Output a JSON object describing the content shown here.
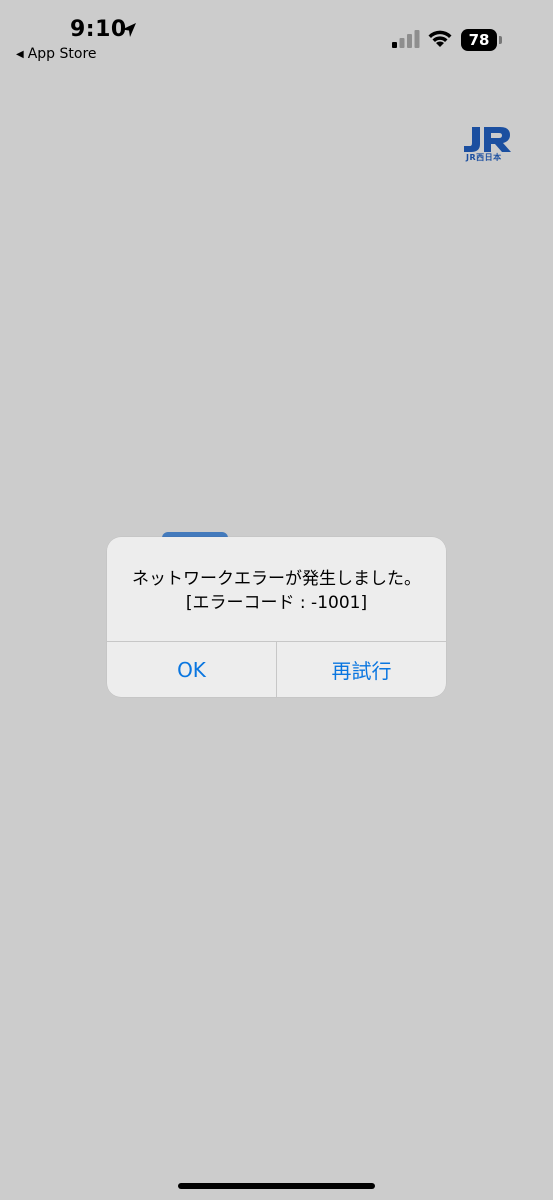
{
  "status_bar": {
    "time": "9:10",
    "back_label": "App Store",
    "battery": "78"
  },
  "logo": {
    "sub_text": "JR西日本"
  },
  "alert": {
    "line1": "ネットワークエラーが発生しました。",
    "line2": "[エラーコード : -1001]",
    "ok_label": "OK",
    "retry_label": "再試行"
  },
  "colors": {
    "background": "#cccccc",
    "alert_bg": "#ededed",
    "button_text": "#0a76e0",
    "logo_blue": "#1b4fa0"
  }
}
